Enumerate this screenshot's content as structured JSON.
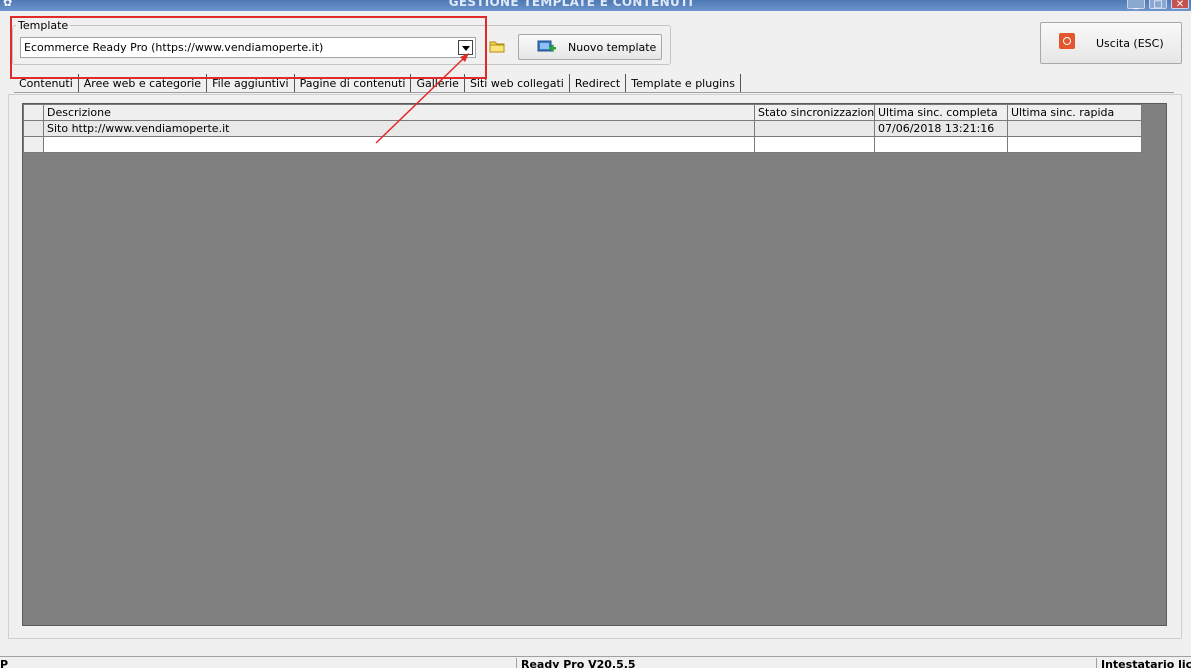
{
  "window": {
    "title": "GESTIONE TEMPLATE E CONTENUTI",
    "icon": "app-icon"
  },
  "template_group": {
    "label": "Template",
    "selected_value": "Ecommerce Ready Pro (https://www.vendiamoperte.it)",
    "folder_icon": "folder-icon"
  },
  "buttons": {
    "new_template": "Nuovo template",
    "exit": "Uscita (ESC)"
  },
  "tabs": [
    {
      "label": "Contenuti"
    },
    {
      "label": "Aree web e categorie"
    },
    {
      "label": "File aggiuntivi"
    },
    {
      "label": "Pagine di contenuti"
    },
    {
      "label": "Gallerie"
    },
    {
      "label": "Siti web collegati",
      "active": true
    },
    {
      "label": "Redirect"
    },
    {
      "label": "Template e plugins"
    }
  ],
  "grid": {
    "columns": [
      "Descrizione",
      "Stato sincronizzazione",
      "Ultima sinc. completa",
      "Ultima sinc. rapida"
    ],
    "rows": [
      [
        "Sito http://www.vendiamoperte.it",
        "",
        "07/06/2018 13:21:16",
        ""
      ],
      [
        "",
        "",
        "",
        ""
      ]
    ]
  },
  "statusbar": {
    "left": "P",
    "version": "Ready Pro V20.5.5",
    "license": "Intestatario licen"
  },
  "annotation": {
    "color": "#e12a2a"
  }
}
